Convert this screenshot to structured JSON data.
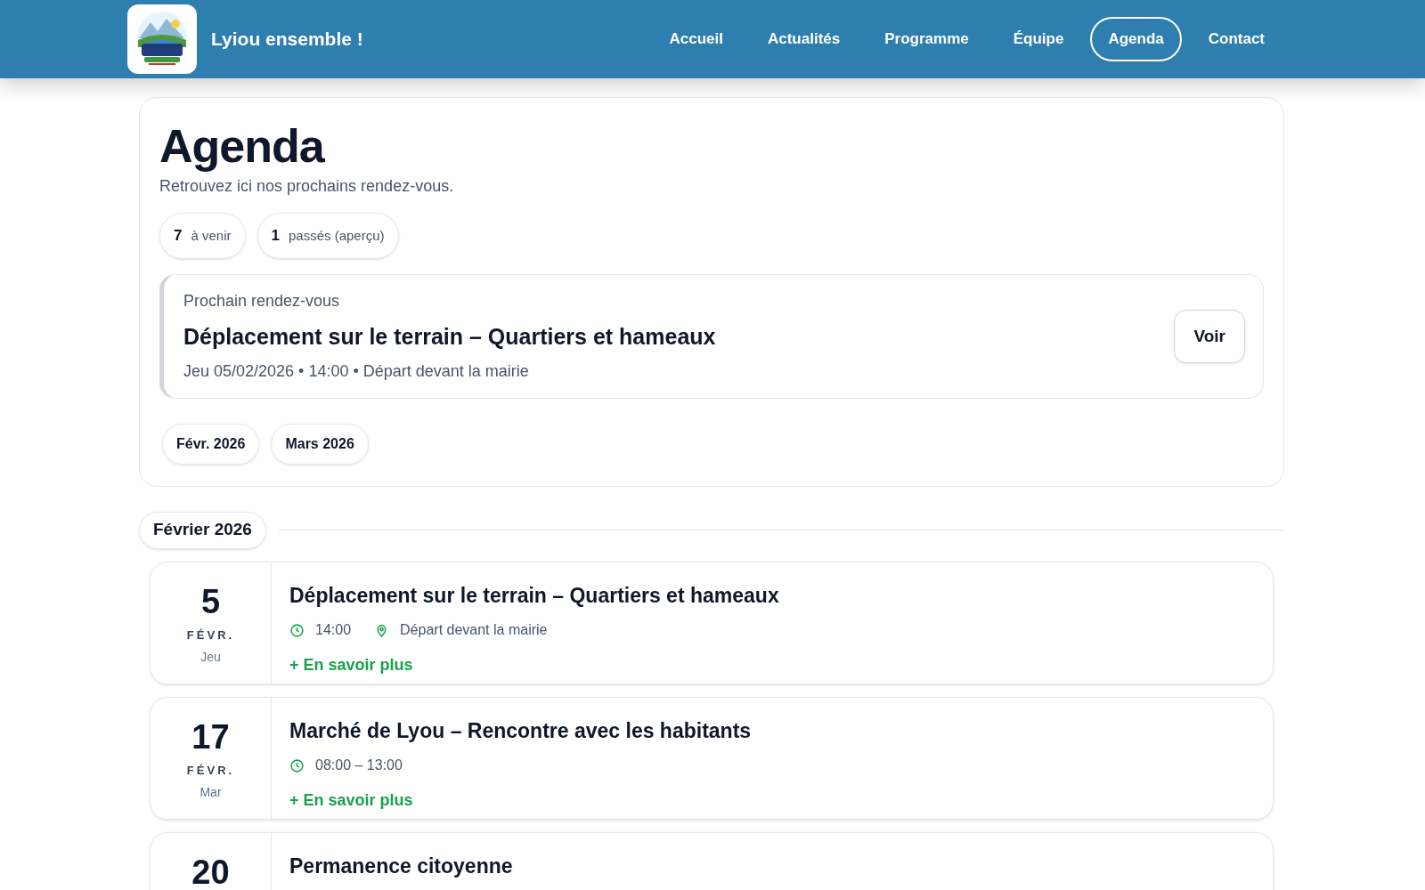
{
  "header": {
    "site_name": "Lyiou ensemble !",
    "nav": [
      {
        "label": "Accueil",
        "selected": false
      },
      {
        "label": "Actualités",
        "selected": false
      },
      {
        "label": "Programme",
        "selected": false
      },
      {
        "label": "Équipe",
        "selected": false
      },
      {
        "label": "Agenda",
        "selected": true
      },
      {
        "label": "Contact",
        "selected": false
      }
    ]
  },
  "intro": {
    "title": "Agenda",
    "subtitle": "Retrouvez ici nos prochains rendez-vous.",
    "counters": [
      {
        "count": "7",
        "label": "à venir"
      },
      {
        "count": "1",
        "label": "passés (aperçu)"
      }
    ],
    "next": {
      "label": "Prochain rendez-vous",
      "title": "Déplacement sur le terrain – Quartiers et hameaux",
      "details": "Jeu 05/02/2026 • 14:00 • Départ devant la mairie",
      "button": "Voir"
    },
    "months": [
      "Févr. 2026",
      "Mars 2026"
    ]
  },
  "sections": [
    {
      "month": "Février 2026",
      "events": [
        {
          "day": "5",
          "month": "FÉVR.",
          "weekday": "Jeu",
          "title": "Déplacement sur le terrain – Quartiers et hameaux",
          "time": "14:00",
          "place": "Départ devant la mairie",
          "more": "+ En savoir plus"
        },
        {
          "day": "17",
          "month": "FÉVR.",
          "weekday": "Mar",
          "title": "Marché de Lyou – Rencontre avec les habitants",
          "time": "08:00 – 13:00",
          "more": "+ En savoir plus"
        },
        {
          "day": "20",
          "title": "Permanence citoyenne"
        }
      ]
    }
  ]
}
